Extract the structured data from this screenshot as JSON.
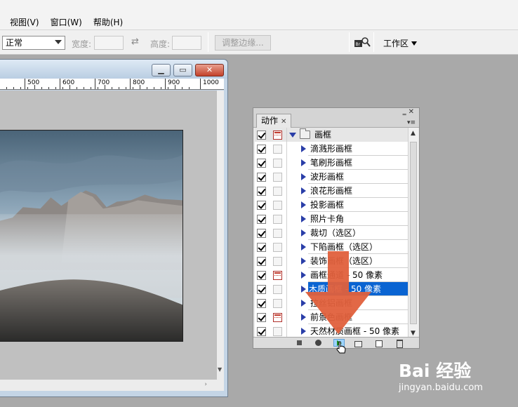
{
  "menubar": {
    "items": [
      {
        "label": "视图(V)"
      },
      {
        "label": "窗口(W)"
      },
      {
        "label": "帮助(H)"
      }
    ]
  },
  "options": {
    "mode_value": "正常",
    "width_label": "宽度:",
    "height_label": "高度:",
    "refine_edge_label": "调整边缘...",
    "workspace_label": "工作区"
  },
  "document": {
    "ruler_labels": [
      "500",
      "600",
      "700",
      "800",
      "900",
      "1000"
    ]
  },
  "actions_panel": {
    "tab_label": "动作",
    "set_name": "画框",
    "actions": [
      {
        "label": "滴溅形画框",
        "checked": true,
        "dialog": false,
        "selected": false
      },
      {
        "label": "笔刷形画框",
        "checked": true,
        "dialog": false,
        "selected": false
      },
      {
        "label": "波形画框",
        "checked": true,
        "dialog": false,
        "selected": false
      },
      {
        "label": "浪花形画框",
        "checked": true,
        "dialog": false,
        "selected": false
      },
      {
        "label": "投影画框",
        "checked": true,
        "dialog": false,
        "selected": false
      },
      {
        "label": "照片卡角",
        "checked": true,
        "dialog": false,
        "selected": false
      },
      {
        "label": "裁切（选区）",
        "checked": true,
        "dialog": false,
        "selected": false
      },
      {
        "label": "下陷画框（选区）",
        "checked": true,
        "dialog": false,
        "selected": false
      },
      {
        "label": "装饰画框（选区）",
        "checked": true,
        "dialog": false,
        "selected": false
      },
      {
        "label": "画框通道 - 50 像素",
        "checked": true,
        "dialog": true,
        "selected": false
      },
      {
        "label": "木质画框 - 50 像素",
        "checked": true,
        "dialog": false,
        "selected": true
      },
      {
        "label": "拉丝铝画框",
        "checked": true,
        "dialog": false,
        "selected": false
      },
      {
        "label": "前景色画框",
        "checked": true,
        "dialog": true,
        "selected": false
      },
      {
        "label": "天然材质画框 - 50 像素",
        "checked": true,
        "dialog": false,
        "selected": false
      }
    ]
  },
  "watermark": {
    "brand": "Bai 经验",
    "url": "jingyan.baidu.com"
  },
  "colors": {
    "accent_selection": "#0a64d2",
    "arrow_overlay": "#e0603c",
    "play_triangle": "#1d8a1d"
  }
}
